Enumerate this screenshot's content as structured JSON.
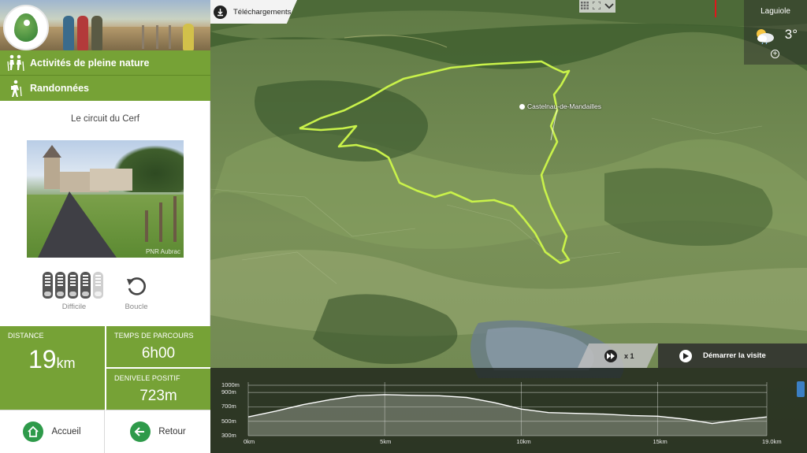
{
  "sidebar": {
    "menu": [
      {
        "label": "Activités de pleine nature",
        "icon": "hikers-icon"
      },
      {
        "label": "Randonnées",
        "icon": "hiker-icon"
      }
    ],
    "trail_name": "Le circuit du Cerf",
    "photo_credit": "PNR Aubrac",
    "difficulty": {
      "label": "Difficile",
      "level": 4,
      "max": 5
    },
    "route_type": {
      "label": "Boucle"
    },
    "stats": {
      "distance_label": "DISTANCE",
      "distance_value": "19",
      "distance_unit": "km",
      "time_label": "TEMPS DE PARCOURS",
      "time_value": "6h00",
      "elevation_label": "DENIVELE POSITIF",
      "elevation_value": "723m"
    },
    "buttons": {
      "home": "Accueil",
      "back": "Retour"
    }
  },
  "map": {
    "downloads_label": "Téléchargements",
    "place_label": "Castelnau-de-Mandailles",
    "weather": {
      "city": "Laguiole",
      "temperature": "3°"
    },
    "playback": {
      "speed": "x 1",
      "start_label": "Démarrer la visite"
    },
    "colors": {
      "route": "#c9f24a",
      "panel_green": "#76a236",
      "button_green": "#2e9a4a"
    }
  },
  "chart_data": {
    "type": "area",
    "title": "",
    "xlabel": "",
    "ylabel": "",
    "x_ticks": [
      "0km",
      "5km",
      "10km",
      "15km",
      "19.0km"
    ],
    "y_ticks": [
      "1000m",
      "900m",
      "700m",
      "500m",
      "300m"
    ],
    "ylim": [
      300,
      1000
    ],
    "xlim": [
      0,
      19
    ],
    "series": [
      {
        "x": [
          0,
          1,
          2,
          3,
          4,
          5,
          6,
          7,
          8,
          9,
          10,
          11,
          12,
          13,
          14,
          15,
          16,
          17,
          18,
          19
        ],
        "values": [
          560,
          640,
          730,
          800,
          855,
          870,
          860,
          855,
          830,
          760,
          670,
          620,
          610,
          600,
          580,
          570,
          530,
          470,
          520,
          560
        ]
      }
    ]
  }
}
